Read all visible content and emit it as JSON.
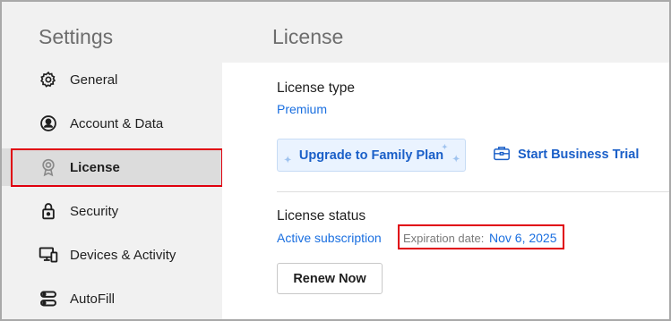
{
  "sidebar": {
    "title": "Settings",
    "items": [
      {
        "label": "General",
        "icon": "gear-icon"
      },
      {
        "label": "Account & Data",
        "icon": "account-icon"
      },
      {
        "label": "License",
        "icon": "badge-icon",
        "active": true
      },
      {
        "label": "Security",
        "icon": "lock-icon"
      },
      {
        "label": "Devices & Activity",
        "icon": "devices-icon"
      },
      {
        "label": "AutoFill",
        "icon": "autofill-icon"
      }
    ]
  },
  "main": {
    "title": "License",
    "license_type": {
      "label": "License type",
      "value": "Premium"
    },
    "upgrade_button": "Upgrade to Family Plan",
    "business_trial_button": "Start Business Trial",
    "license_status": {
      "label": "License status",
      "value": "Active subscription",
      "expiration_label": "Expiration date:",
      "expiration_value": "Nov 6, 2025"
    },
    "renew_button": "Renew Now"
  },
  "colors": {
    "accent": "#1a6fe0",
    "highlight": "#e0000d",
    "active_item_bg": "#dcdcdc"
  }
}
